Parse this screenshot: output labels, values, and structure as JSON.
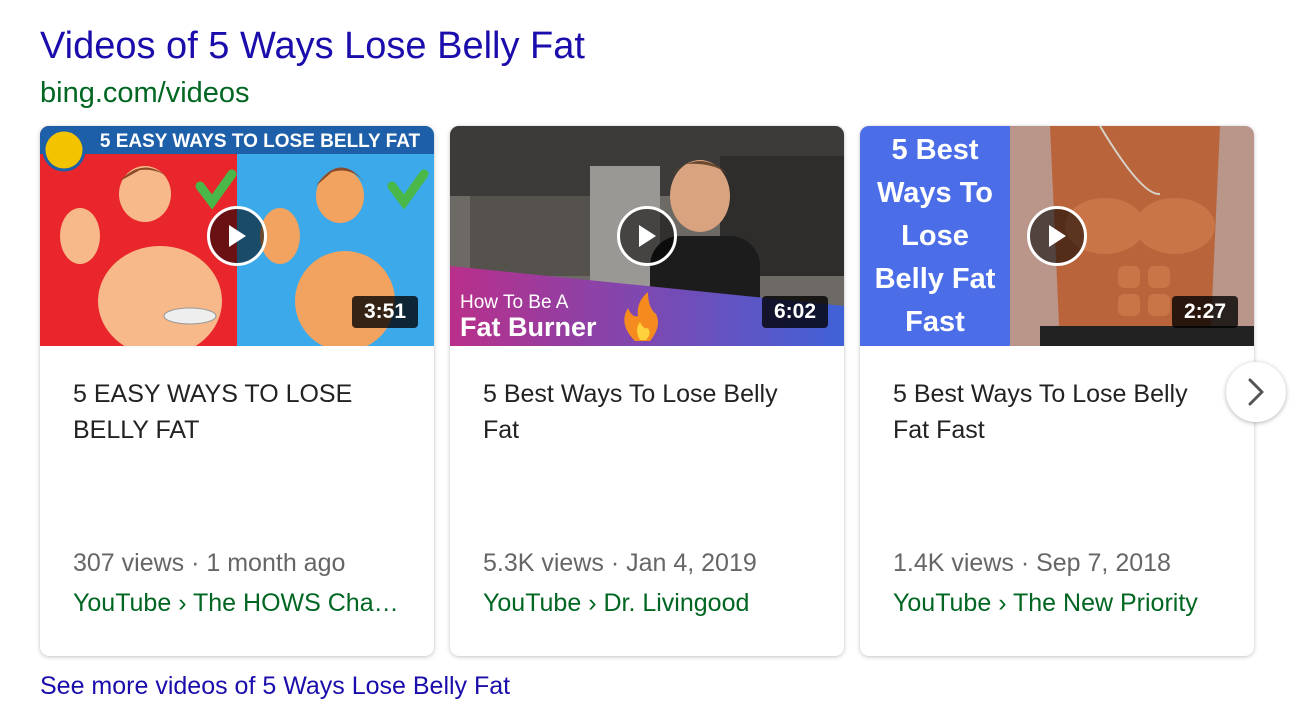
{
  "header": {
    "title": "Videos of 5 Ways Lose Belly Fat",
    "source": "bing.com/videos"
  },
  "cards": [
    {
      "thumbnail_banner": "5 EASY WAYS TO LOSE BELLY FAT",
      "duration": "3:51",
      "title": "5 EASY WAYS TO LOSE BELLY FAT",
      "meta": "307 views · 1 month ago",
      "channel": "YouTube › The HOWS Chan…"
    },
    {
      "thumbnail_line1": "How To Be A",
      "thumbnail_line2": "Fat Burner",
      "duration": "6:02",
      "title": "5 Best Ways To Lose Belly Fat",
      "meta": "5.3K views · Jan 4, 2019",
      "channel": "YouTube › Dr. Livingood"
    },
    {
      "thumbnail_lines": [
        "5 Best",
        "Ways To",
        "Lose",
        "Belly Fat",
        "Fast"
      ],
      "duration": "2:27",
      "title": "5 Best Ways To Lose Belly Fat Fast",
      "meta": "1.4K views · Sep 7, 2018",
      "channel": "YouTube › The New Priority"
    }
  ],
  "see_more": "See more videos of 5 Ways Lose Belly Fat",
  "icons": {
    "play": "play-icon",
    "next": "chevron-right-icon",
    "checkmark": "checkmark-icon",
    "fire": "fire-icon"
  },
  "colors": {
    "link": "#1a0dab",
    "url_green": "#006621",
    "meta_gray": "#666666"
  }
}
